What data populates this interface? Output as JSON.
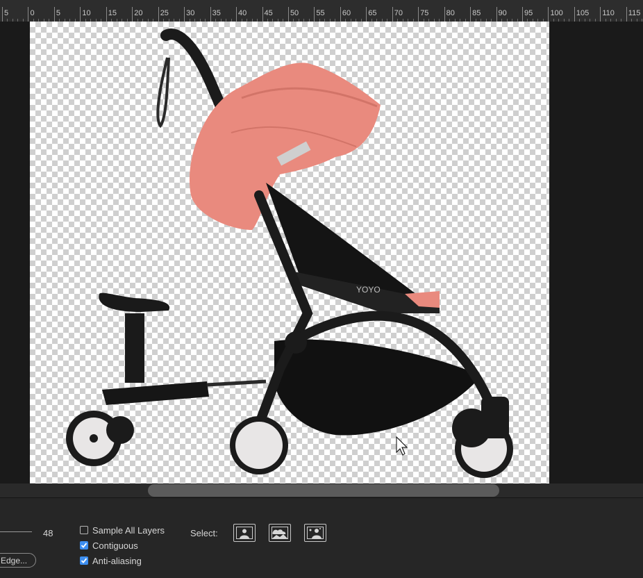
{
  "ruler": {
    "labels": [
      "5",
      "0",
      "5",
      "10",
      "15",
      "20",
      "25",
      "30",
      "35",
      "40",
      "45",
      "50",
      "55",
      "60",
      "65",
      "70",
      "75",
      "80",
      "85",
      "90",
      "95",
      "100",
      "105",
      "110",
      "115"
    ]
  },
  "canvas": {
    "image": "stroller-with-ride-on-board",
    "brand_text": "YOYO"
  },
  "options": {
    "slider_value": "48",
    "refine_edge_label": "Edge...",
    "sample_all_layers": {
      "label": "Sample All Layers",
      "checked": false
    },
    "contiguous": {
      "label": "Contiguous",
      "checked": true
    },
    "anti_aliasing": {
      "label": "Anti-aliasing",
      "checked": true
    },
    "select_label": "Select:",
    "select_icons": [
      "subject-select-icon",
      "sky-select-icon",
      "people-select-icon"
    ]
  },
  "colors": {
    "accent": "#3d8ef0",
    "canopy": "#e98a7e",
    "frame": "#1b1b1b"
  }
}
